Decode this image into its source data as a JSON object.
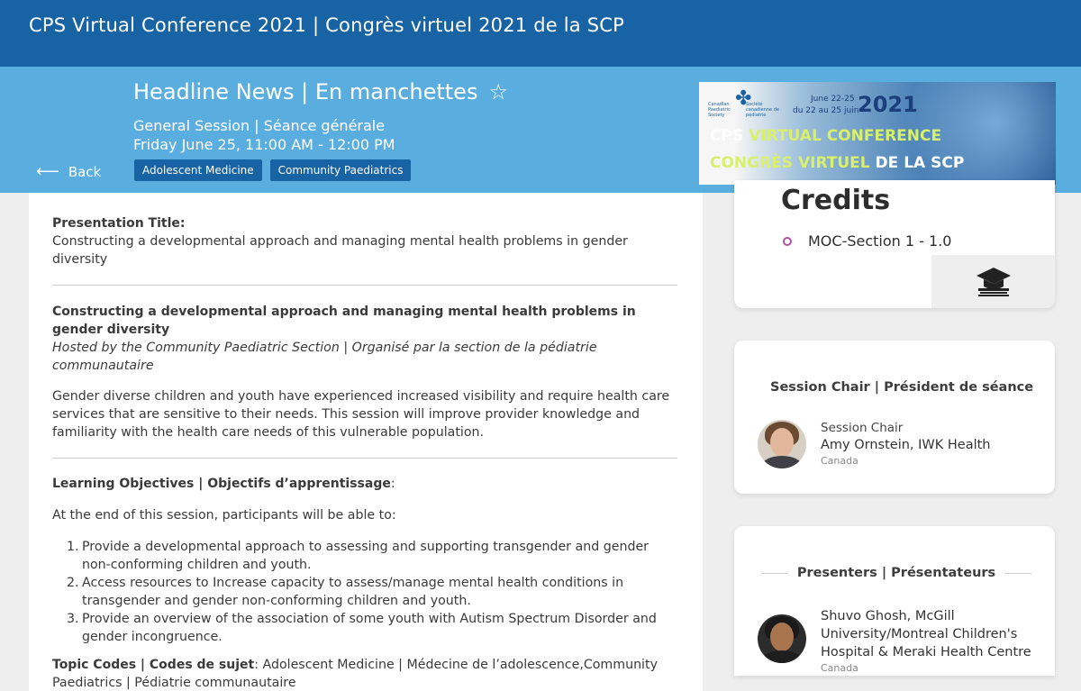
{
  "app": {
    "title": "CPS Virtual Conference 2021 | Congrès virtuel 2021 de la SCP"
  },
  "session": {
    "title": "Headline News | En manchettes",
    "type": "General Session | Séance générale",
    "time": "Friday June 25, 11:00 AM - 12:00 PM",
    "back_label": "Back",
    "tags": [
      "Adolescent Medicine",
      "Community Paediatrics"
    ]
  },
  "banner": {
    "society_en": "Canadian Paediatric Society",
    "society_fr": "Société canadienne de pédiatrie",
    "dates_en": "June 22-25",
    "dates_fr": "du 22 au 25 juin",
    "year": "2021",
    "conference_en_prefix": "CPS ",
    "conference_en_highlight": "VIRTUAL CONFERENCE",
    "conference_fr_highlight": "CONGRÈS VIRTUEL",
    "conference_fr_suffix": " DE LA SCP"
  },
  "content": {
    "presentation_title_label": "Presentation Title:",
    "presentation_title": "Constructing a developmental approach and managing mental health problems in gender diversity",
    "heading": "Constructing a developmental approach and managing mental health problems in gender diversity",
    "hosted_by": "Hosted by the Community Paediatric Section | Organisé par la section de la pédiatrie communautaire",
    "description": "Gender diverse children and youth have experienced increased visibility and require health care services that are sensitive to their needs. This session will improve provider knowledge and familiarity with the health care needs of this vulnerable population.",
    "objectives_label": "Learning Objectives | Objectifs d’apprentissage",
    "objectives_intro": "At the end of this session, participants will be able to:",
    "objectives": [
      "Provide a developmental approach to assessing and supporting transgender and gender non-conforming children and youth.",
      "Access resources to Increase capacity to assess/manage mental health conditions in transgender and gender non-conforming children and youth.",
      "Provide an overview of the association of some youth with Autism Spectrum Disorder and gender incongruence."
    ],
    "topic_codes_label": "Topic Codes | Codes de sujet",
    "topic_codes": "Adolescent Medicine | Médecine de l’adolescence,Community Paediatrics | Pédiatrie communautaire"
  },
  "credits": {
    "title": "Credits",
    "items": [
      "MOC-Section 1 - 1.0"
    ],
    "icon": "graduation-cap-icon"
  },
  "session_chair": {
    "heading": "Session Chair | Président de séance",
    "role": "Session Chair",
    "name": "Amy Ornstein, IWK Health",
    "country": "Canada"
  },
  "presenters": {
    "heading": "Presenters | Présentateurs",
    "items": [
      {
        "name": "Shuvo Ghosh, McGill University/Montreal Children's Hospital & Meraki Health Centre",
        "country": "Canada"
      }
    ]
  },
  "colors": {
    "topbar": "#1863a3",
    "header": "#5aaedf",
    "tag": "#1863a3",
    "bullet": "#b5519a"
  }
}
